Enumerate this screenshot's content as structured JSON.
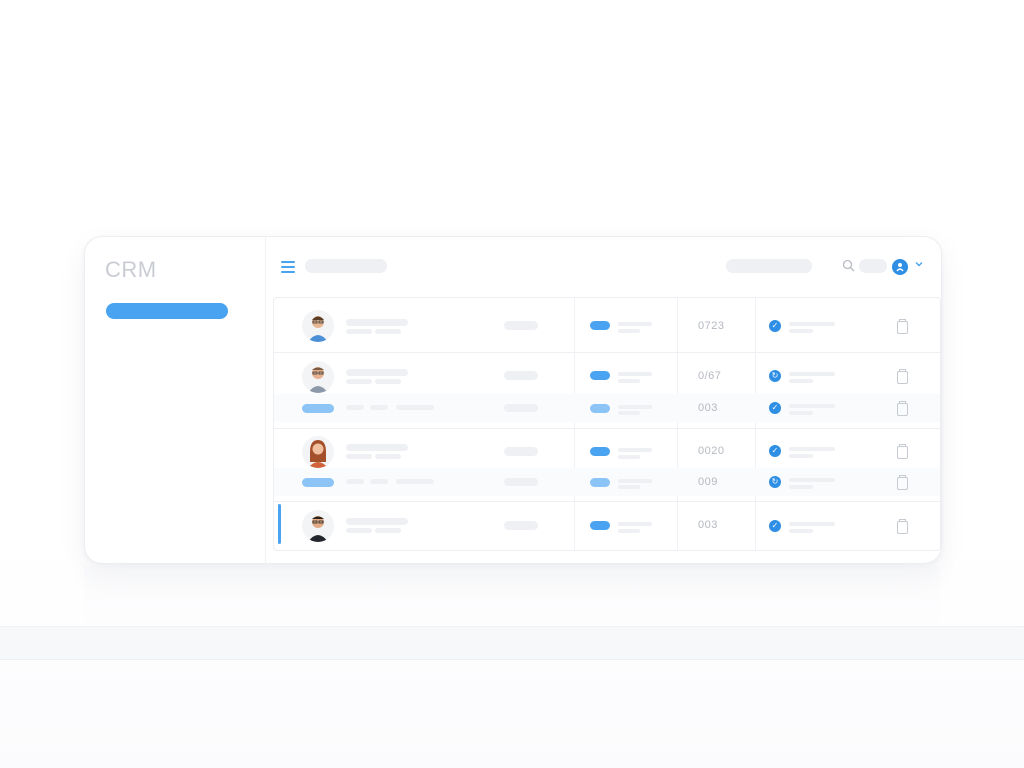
{
  "app": {
    "brand": "CRM"
  },
  "icons": {
    "menu": "hamburger-menu-icon",
    "search": "search-icon",
    "user": "user-avatar-icon",
    "chevron": "chevron-down-icon",
    "status": "status-icon",
    "delete": "trash-icon"
  },
  "colors": {
    "accent": "#4aa3f0",
    "accent_dark": "#2f8fe4",
    "muted_text": "#b4b8c0",
    "placeholder": "#eef0f3"
  },
  "table": {
    "rows": [
      {
        "id": "0723"
      },
      {
        "id": "0/67",
        "sub_id": "003"
      },
      {
        "id": "0020",
        "sub_id": "009"
      },
      {
        "id": "003"
      }
    ]
  }
}
